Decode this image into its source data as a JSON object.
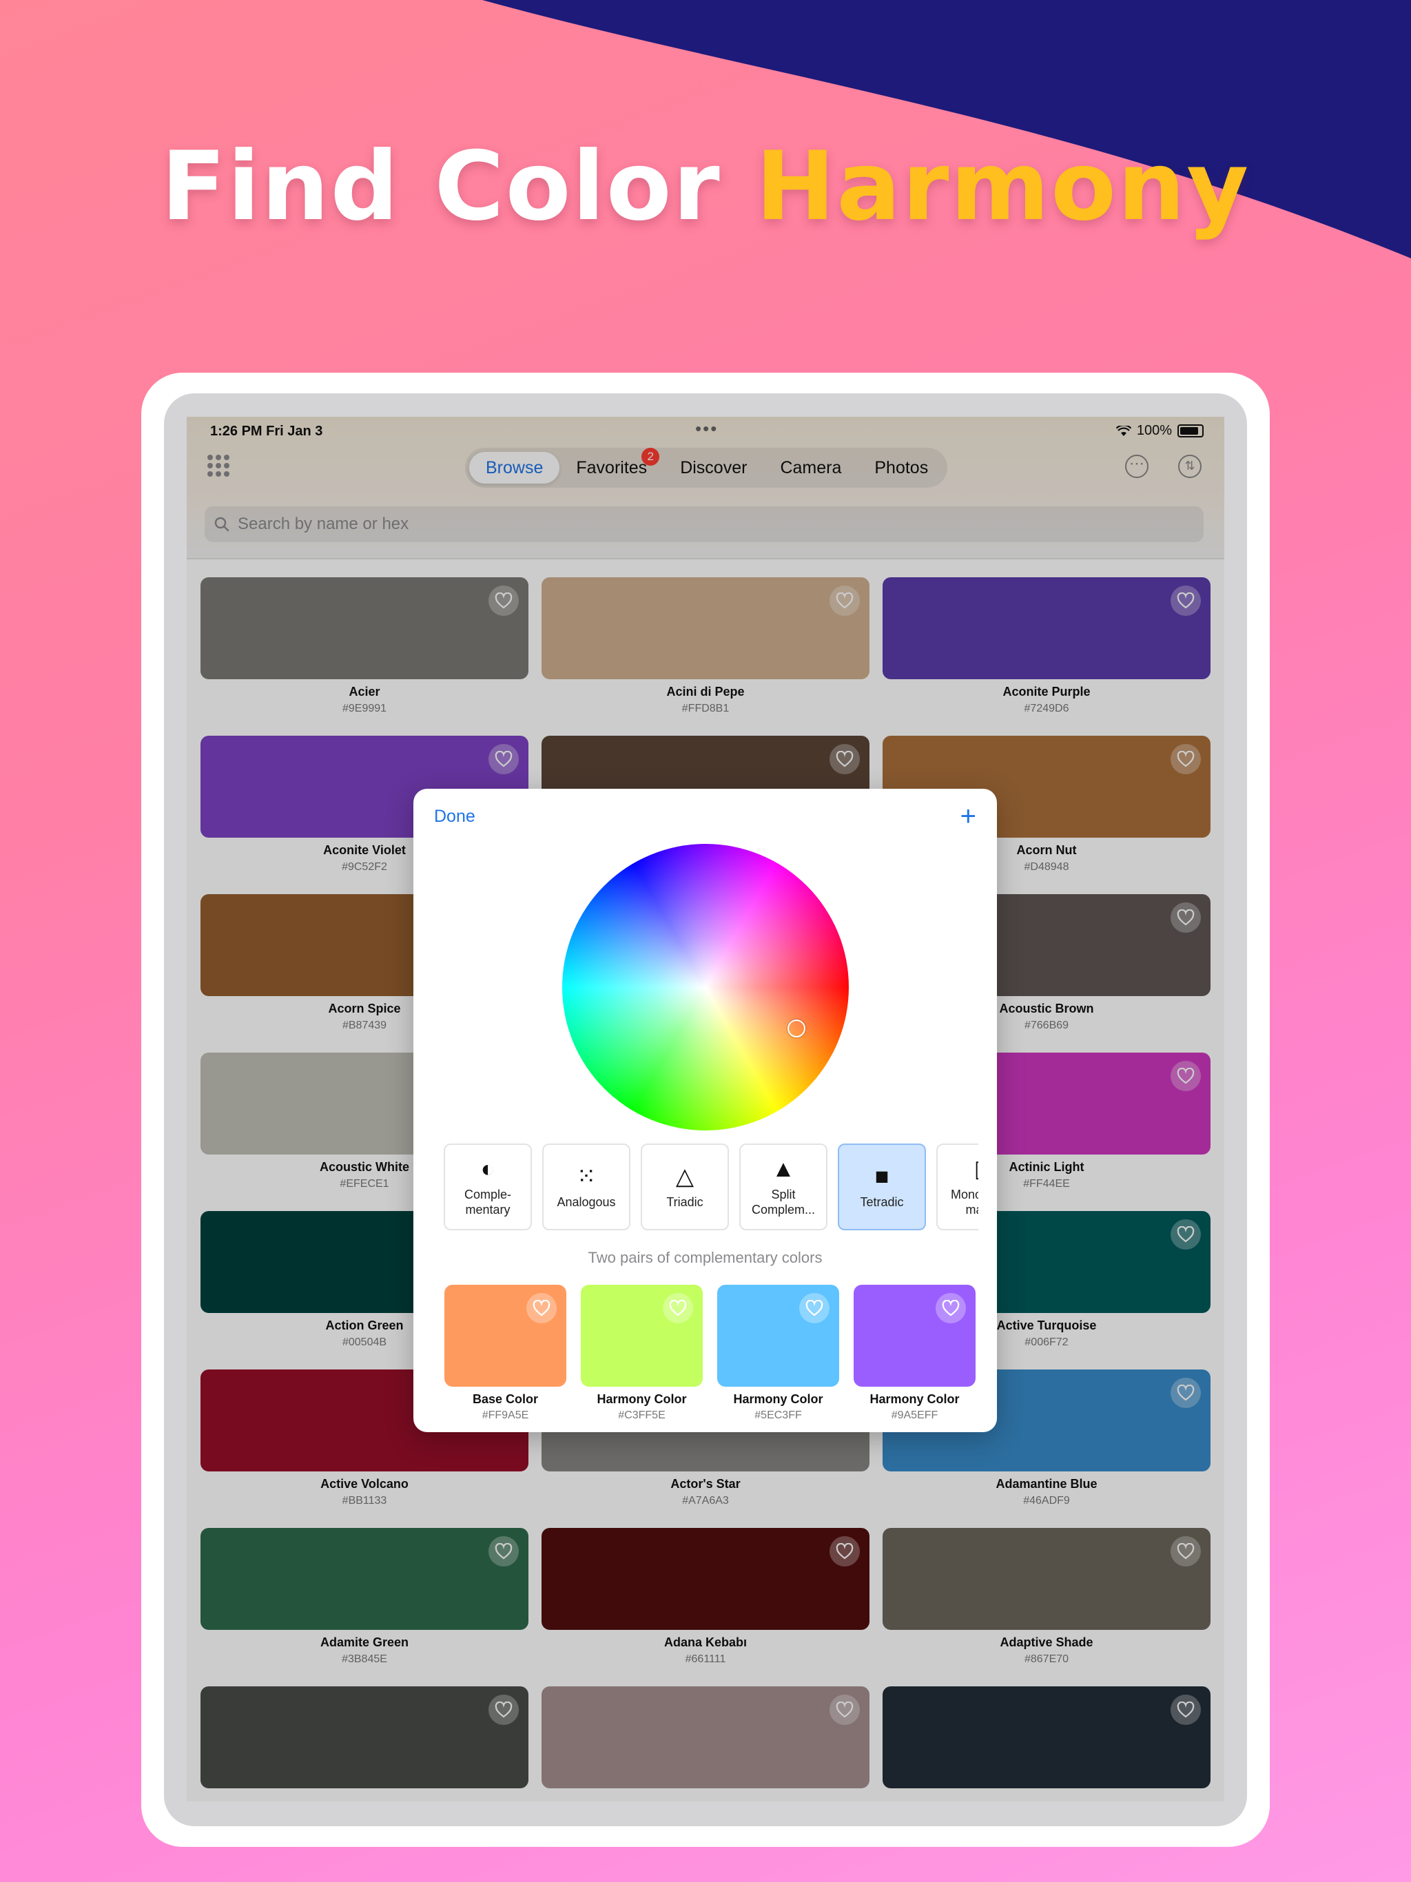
{
  "headline": {
    "part1": "Find Color ",
    "part2": "Harmony"
  },
  "colors": {
    "accent": "#ffbf1f",
    "link": "#1e74e8",
    "swoop": "#1d1a7a"
  },
  "status_bar": {
    "time": "1:26 PM   Fri Jan 3",
    "dots": "•••",
    "battery": "100%"
  },
  "nav": {
    "tabs": [
      {
        "label": "Browse",
        "active": true
      },
      {
        "label": "Favorites",
        "badge": "2"
      },
      {
        "label": "Discover"
      },
      {
        "label": "Camera"
      },
      {
        "label": "Photos"
      }
    ],
    "more_glyph": "⋯",
    "sort_glyph": "⇅"
  },
  "search": {
    "placeholder": "Search by name or hex"
  },
  "colors_grid": [
    {
      "name": "Acier",
      "hex": "#9E9991",
      "color": "#7b7873"
    },
    {
      "name": "Acini di Pepe",
      "hex": "#FFD8B1",
      "color": "#cfae8e"
    },
    {
      "name": "Aconite Purple",
      "hex": "#7249D6",
      "color": "#5b3bab"
    },
    {
      "name": "Aconite Violet",
      "hex": "#9C52F2",
      "color": "#7c42c2"
    },
    {
      "name": "",
      "hex": "",
      "color": "#5a4436"
    },
    {
      "name": "Acorn Nut",
      "hex": "#D48948",
      "color": "#a96e3a"
    },
    {
      "name": "Acorn Spice",
      "hex": "#B87439",
      "color": "#935d2e"
    },
    {
      "name": "",
      "hex": "",
      "color": "#7d6f69"
    },
    {
      "name": "Acoustic Brown",
      "hex": "#766B69",
      "color": "#5e5654"
    },
    {
      "name": "Acoustic White",
      "hex": "#EFECE1",
      "color": "#bfbdb4"
    },
    {
      "name": "",
      "hex": "",
      "color": "#c9a9c0"
    },
    {
      "name": "Actinic Light",
      "hex": "#FF44EE",
      "color": "#cc36be"
    },
    {
      "name": "Action Green",
      "hex": "#00504B",
      "color": "#00403c"
    },
    {
      "name": "",
      "hex": "",
      "color": "#3a5a58"
    },
    {
      "name": "Active Turquoise",
      "hex": "#006F72",
      "color": "#00595b"
    },
    {
      "name": "Active Volcano",
      "hex": "#BB1133",
      "color": "#960e29"
    },
    {
      "name": "Actor's Star",
      "hex": "#A7A6A3",
      "color": "#868582"
    },
    {
      "name": "Adamantine Blue",
      "hex": "#46ADF9",
      "color": "#388ac7"
    },
    {
      "name": "Adamite Green",
      "hex": "#3B845E",
      "color": "#2f6a4b"
    },
    {
      "name": "Adana Kebabı",
      "hex": "#661111",
      "color": "#520e0e"
    },
    {
      "name": "Adaptive Shade",
      "hex": "#867E70",
      "color": "#6b655a"
    },
    {
      "name": "",
      "hex": "",
      "color": "#484c48"
    },
    {
      "name": "",
      "hex": "",
      "color": "#a48e8e"
    },
    {
      "name": "",
      "hex": "",
      "color": "#222d39"
    }
  ],
  "sheet": {
    "done": "Done",
    "add": "+",
    "modes": [
      {
        "label": "Comple-\nmentary",
        "icon": "◐"
      },
      {
        "label": "Analogous",
        "icon": "⁙"
      },
      {
        "label": "Triadic",
        "icon": "△"
      },
      {
        "label": "Split\nComplem...",
        "icon": "▲"
      },
      {
        "label": "Tetradic",
        "icon": "■",
        "selected": true
      },
      {
        "label": "Monochro-\nmatic",
        "icon": "▯"
      }
    ],
    "description": "Two pairs of complementary colors",
    "harmony": [
      {
        "name": "Base Color",
        "hex": "#FF9A5E",
        "color": "#ff9a5e"
      },
      {
        "name": "Harmony Color",
        "hex": "#C3FF5E",
        "color": "#c3ff5e"
      },
      {
        "name": "Harmony Color",
        "hex": "#5EC3FF",
        "color": "#5ec3ff"
      },
      {
        "name": "Harmony Color",
        "hex": "#9A5EFF",
        "color": "#9a5eff"
      }
    ]
  }
}
